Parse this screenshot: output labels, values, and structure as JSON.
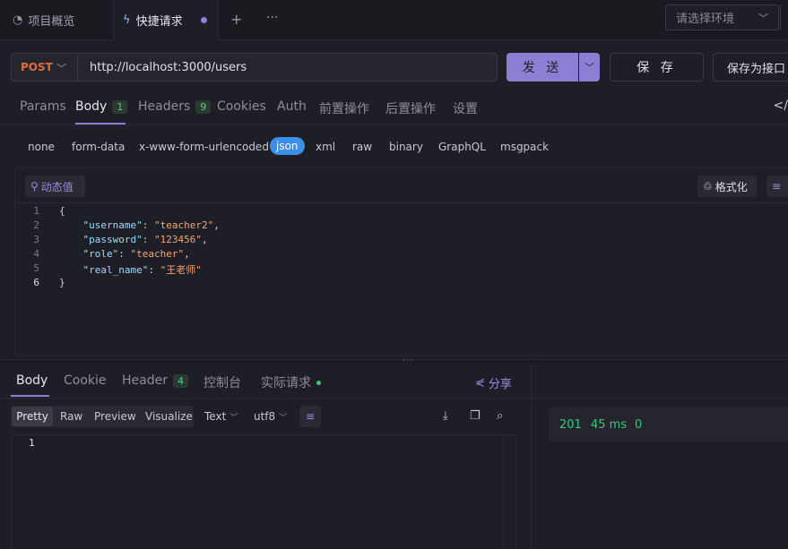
{
  "tabs": {
    "project": "项目概览",
    "active": "快捷请求",
    "add": "+",
    "more": "···"
  },
  "env": {
    "placeholder": "请选择环境"
  },
  "request": {
    "method": "POST",
    "url": "http://localhost:3000/users",
    "send_label": "发 送",
    "save_label": "保 存",
    "save_as_label": "保存为接口"
  },
  "req_tabs": [
    {
      "label": "Params"
    },
    {
      "label": "Body",
      "badge": "1"
    },
    {
      "label": "Headers",
      "badge": "9"
    },
    {
      "label": "Cookies"
    },
    {
      "label": "Auth"
    },
    {
      "label": "前置操作"
    },
    {
      "label": "后置操作"
    },
    {
      "label": "设置"
    }
  ],
  "body_types": [
    "none",
    "form-data",
    "x-www-form-urlencoded",
    "json",
    "xml",
    "raw",
    "binary",
    "GraphQL",
    "msgpack"
  ],
  "editor": {
    "dynamic_label": "动态值",
    "format_label": "格式化",
    "line_numbers": [
      "1",
      "2",
      "3",
      "4",
      "5",
      "6"
    ],
    "lines": {
      "open": "{",
      "k1": "\"username\"",
      "v1": "\"teacher2\"",
      "k2": "\"password\"",
      "v2": "\"123456\"",
      "k3": "\"role\"",
      "v3": "\"teacher\"",
      "k4": "\"real_name\"",
      "v4": "\"王老师\"",
      "close": "}"
    }
  },
  "response": {
    "tabs": [
      {
        "label": "Body"
      },
      {
        "label": "Cookie"
      },
      {
        "label": "Header",
        "badge": "4"
      },
      {
        "label": "控制台"
      },
      {
        "label": "实际请求"
      }
    ],
    "share_label": "分享",
    "formats": [
      "Pretty",
      "Raw",
      "Preview",
      "Visualize"
    ],
    "type_select": "Text",
    "encoding_select": "utf8",
    "line_number": "1",
    "status_code": "201",
    "time": "45 ms",
    "size": "0"
  }
}
